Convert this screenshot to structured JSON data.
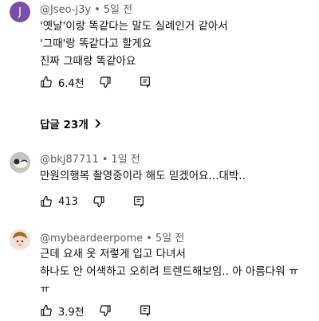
{
  "comments": [
    {
      "avatar_letter": "J",
      "handle": "@Jseo-j3y",
      "time": "5일 전",
      "lines": [
        "'옛날'이랑 똑같다는 말도 실례인거 같아서",
        "'그때'랑 똑같다고 할게요",
        "진짜 그때랑 똑같아요"
      ],
      "likes": "6.4천",
      "replies_label": "답글 23개"
    },
    {
      "handle": "@bkj87711",
      "time": "1일 전",
      "lines": [
        "만원의행복 촬영중이라 해도 믿겠어요...대박.."
      ],
      "likes": "413"
    },
    {
      "handle": "@mybeardeerpome",
      "time": "5일 전",
      "lines": [
        "근데 요새 옷 저렇게 입고 다녀서",
        "하나도 안 어색하고 오히려 트렌드해보임.. 아 아름다워 ㅠ",
        "ㅠ"
      ],
      "likes": "3.9천"
    }
  ],
  "colors": {
    "avatar_purple": "#7b4fa8",
    "meta_gray": "#606060",
    "text": "#0f0f0f"
  },
  "icons": [
    "thumb-up-icon",
    "thumb-down-icon",
    "reply-comment-icon",
    "chevron-right-icon"
  ]
}
